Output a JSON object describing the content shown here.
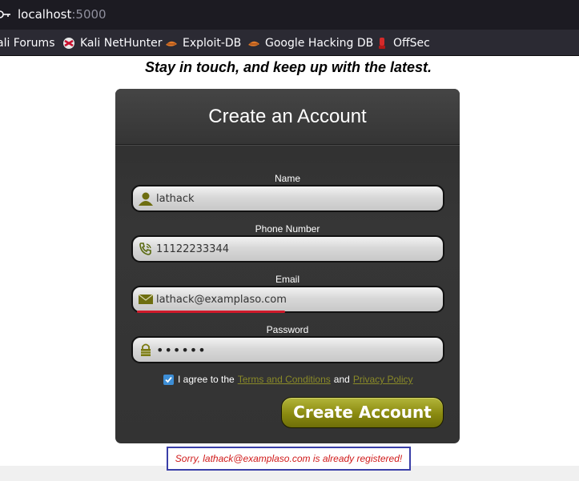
{
  "browser": {
    "url_host": "localhost",
    "url_port": ":5000",
    "bookmarks": [
      {
        "label": "ali Forums",
        "icon": "kali-forums-icon"
      },
      {
        "label": "Kali NetHunter",
        "icon": "nethunter-icon"
      },
      {
        "label": "Exploit-DB",
        "icon": "exploit-db-icon"
      },
      {
        "label": "Google Hacking DB",
        "icon": "ghdb-icon"
      },
      {
        "label": "OffSec",
        "icon": "offsec-icon"
      }
    ]
  },
  "page": {
    "tagline": "Stay in touch, and keep up with the latest.",
    "form": {
      "title": "Create an Account",
      "name_label": "Name",
      "name_value": "lathack",
      "phone_label": "Phone Number",
      "phone_value": "11122233344",
      "email_label": "Email",
      "email_value": "lathack@examplaso.com",
      "password_label": "Password",
      "password_value": "••••••",
      "agree_prefix": "I agree to the",
      "terms_link": "Terms and Conditions",
      "agree_and": "and",
      "privacy_link": "Privacy Policy",
      "agree_checked": true,
      "submit_label": "Create Account"
    },
    "error_message": "Sorry, lathack@examplaso.com is already registered!"
  },
  "colors": {
    "accent_olive": "#8a8a10",
    "error_red": "#d01a1a",
    "error_border": "#3a3fa8",
    "checkbox_blue": "#3d8ed6"
  }
}
